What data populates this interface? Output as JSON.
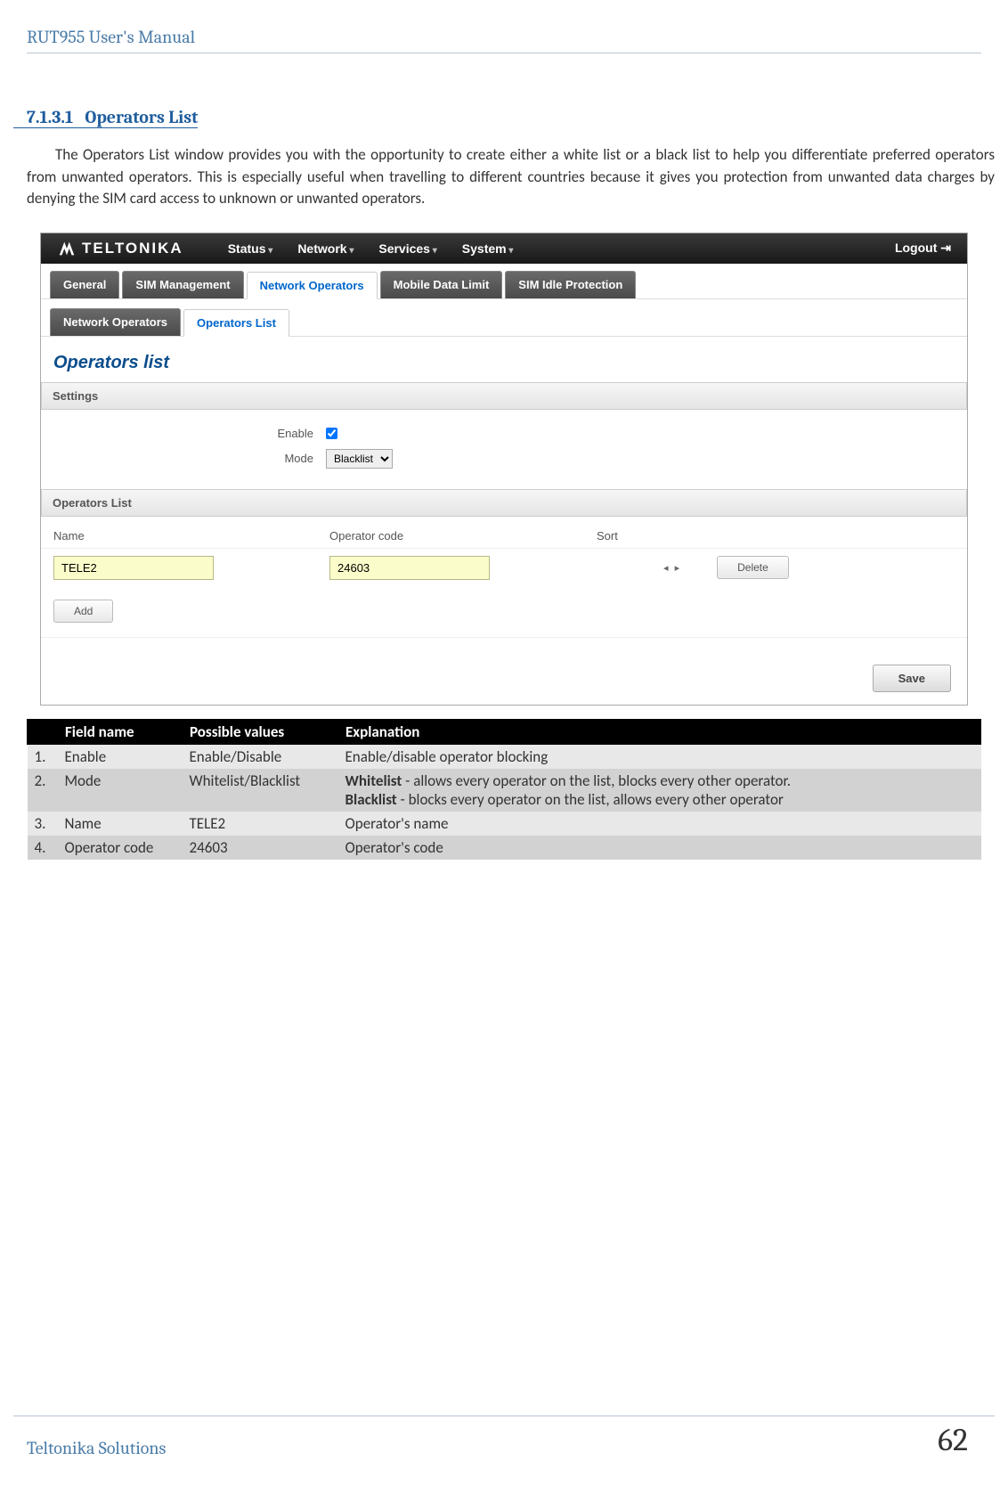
{
  "doc": {
    "title": "RUT955 User's Manual",
    "section_number": "7.1.3.1",
    "section_title": "Operators List",
    "paragraph": "The Operators List window provides you with the opportunity to create either a white list or a black list to help you differentiate preferred operators from unwanted operators. This is especially useful when travelling to different countries because it gives you protection from unwanted data charges by denying the SIM card access to unknown or unwanted operators.",
    "footer_left": "Teltonika Solutions",
    "page_number": "62"
  },
  "ui": {
    "brand": "TELTONIKA",
    "nav": [
      "Status",
      "Network",
      "Services",
      "System"
    ],
    "logout": "Logout",
    "tabs": [
      "General",
      "SIM Management",
      "Network Operators",
      "Mobile Data Limit",
      "SIM Idle Protection"
    ],
    "active_tab_index": 2,
    "subtabs": [
      "Network Operators",
      "Operators List"
    ],
    "active_subtab_index": 1,
    "page_title": "Operators list",
    "settings_header": "Settings",
    "enable_label": "Enable",
    "enable_checked": true,
    "mode_label": "Mode",
    "mode_value": "Blacklist",
    "list_header": "Operators List",
    "columns": {
      "name": "Name",
      "code": "Operator code",
      "sort": "Sort"
    },
    "rows": [
      {
        "name": "TELE2",
        "code": "24603"
      }
    ],
    "delete_label": "Delete",
    "add_label": "Add",
    "save_label": "Save"
  },
  "table": {
    "headers": [
      "",
      "Field name",
      "Possible values",
      "Explanation"
    ],
    "rows": [
      {
        "n": "1.",
        "field": "Enable",
        "values": "Enable/Disable",
        "expl_plain": "Enable/disable operator blocking"
      },
      {
        "n": "2.",
        "field": "Mode",
        "values": "Whitelist/Blacklist",
        "bold1": "Whitelist",
        "rest1": " - allows every operator on the list, blocks every other operator.",
        "bold2": "Blacklist",
        "rest2": " - blocks every operator on the list, allows every other operator"
      },
      {
        "n": "3.",
        "field": "Name",
        "values": "TELE2",
        "expl_plain": "Operator's name"
      },
      {
        "n": "4.",
        "field": "Operator code",
        "values": "24603",
        "expl_plain": "Operator's code"
      }
    ]
  }
}
